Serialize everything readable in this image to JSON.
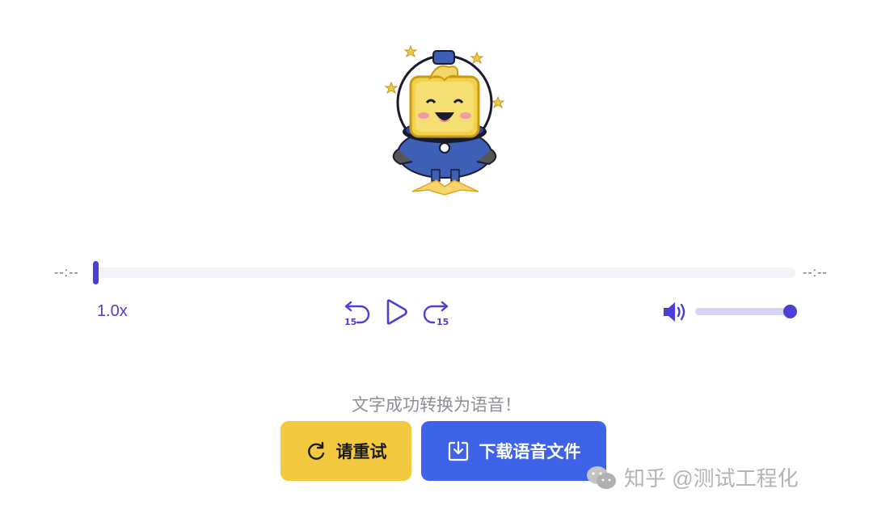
{
  "player": {
    "current_time": "--:--",
    "duration": "--:--",
    "progress_fraction": 0,
    "speed": "1.0x",
    "skip_back_seconds": "15",
    "skip_forward_seconds": "15",
    "volume_fraction": 0.92
  },
  "status_message": "文字成功转换为语音！",
  "buttons": {
    "retry_label": "请重试",
    "download_label": "下载语音文件"
  },
  "watermark": "知乎 @测试工程化",
  "colors": {
    "accent": "#4b3fd6",
    "retry_bg": "#f3c940",
    "download_bg": "#3f63e8",
    "status_text": "#8e8e96"
  },
  "icons": {
    "retry": "refresh-icon",
    "download": "download-icon",
    "play": "play-icon",
    "rewind": "rewind-15-icon",
    "forward": "forward-15-icon",
    "volume": "volume-icon"
  }
}
